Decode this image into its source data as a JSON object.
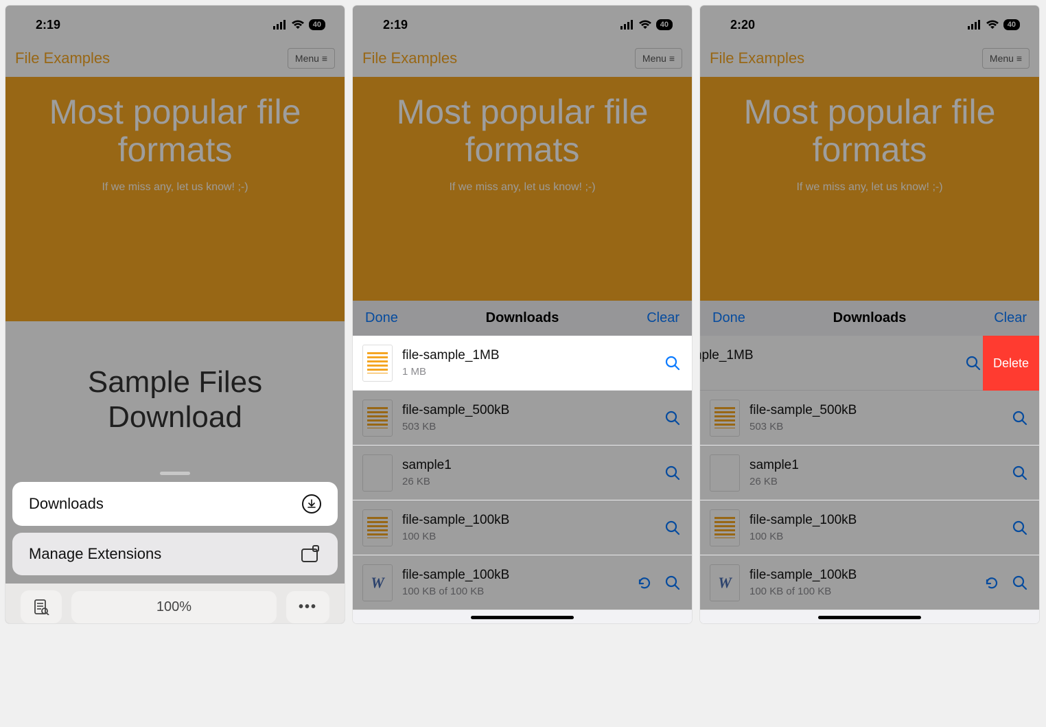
{
  "status": {
    "time1": "2:19",
    "time2": "2:19",
    "time3": "2:20",
    "battery": "40"
  },
  "site": {
    "title": "File Examples",
    "menu": "Menu"
  },
  "hero": {
    "heading": "Most popular file formats",
    "sub": "If we miss any, let us know! ;-)"
  },
  "section": {
    "sample_title": "Sample Files Download"
  },
  "sheet": {
    "downloads_label": "Downloads",
    "manage_ext": "Manage Extensions",
    "zoom": "100%"
  },
  "dl": {
    "done": "Done",
    "title": "Downloads",
    "clear": "Clear",
    "delete": "Delete",
    "items": [
      {
        "name": "file-sample_1MB",
        "size": "1 MB"
      },
      {
        "name": "file-sample_500kB",
        "size": "503 KB"
      },
      {
        "name": "sample1",
        "size": "26 KB"
      },
      {
        "name": "file-sample_100kB",
        "size": "100 KB"
      },
      {
        "name": "file-sample_100kB",
        "size": "100 KB of 100 KB"
      }
    ]
  }
}
